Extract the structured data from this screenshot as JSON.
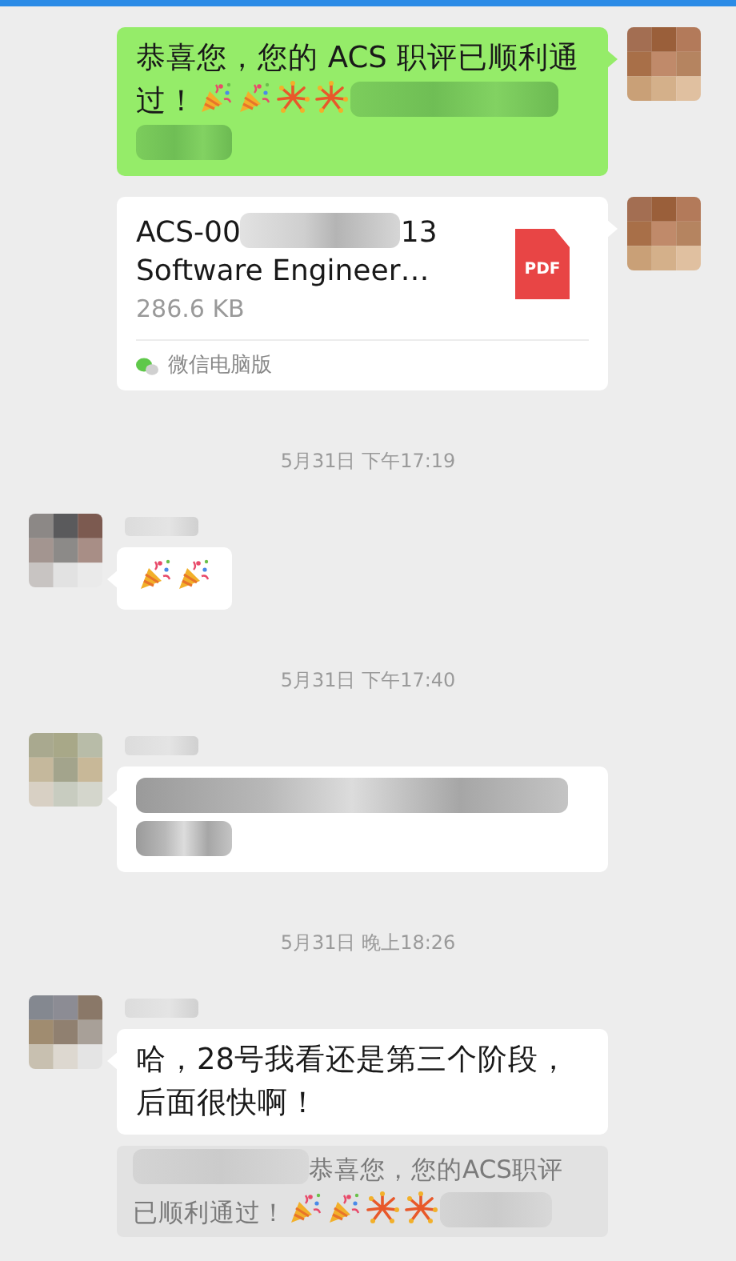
{
  "messages": [
    {
      "kind": "message",
      "outgoing": true,
      "segments": [
        {
          "kind": "text",
          "text": "恭喜您，您的 ACS 职评已顺利通"
        },
        {
          "kind": "text",
          "text": "过！"
        },
        {
          "kind": "popper"
        },
        {
          "kind": "popper"
        },
        {
          "kind": "fireworks"
        },
        {
          "kind": "fireworks"
        },
        {
          "kind": "redacted"
        },
        {
          "kind": "redacted"
        }
      ]
    },
    {
      "kind": "file",
      "outgoing": true,
      "title": [
        {
          "kind": "text",
          "text": "ACS-00"
        },
        {
          "kind": "redacted"
        },
        {
          "kind": "text",
          "text": "13"
        }
      ],
      "subtitle": "Software Engineer…",
      "size": "286.6 KB",
      "file_type": "PDF",
      "source": "微信电脑版"
    },
    {
      "kind": "time",
      "text": "5月31日 下午17:19"
    },
    {
      "kind": "message",
      "outgoing": false,
      "segments": [
        {
          "kind": "popper"
        },
        {
          "kind": "popper"
        }
      ]
    },
    {
      "kind": "time",
      "text": "5月31日 下午17:40"
    },
    {
      "kind": "message",
      "outgoing": false,
      "segments": [
        {
          "kind": "redacted"
        },
        {
          "kind": "redacted"
        }
      ]
    },
    {
      "kind": "time",
      "text": "5月31日 晚上18:26"
    },
    {
      "kind": "message",
      "outgoing": false,
      "segments": [
        {
          "kind": "text",
          "text": "哈，28号我看还是第三个阶段，后面很快啊！"
        }
      ],
      "quote": [
        {
          "kind": "redacted"
        },
        {
          "kind": "text",
          "text": "恭喜您，您的ACS职评"
        },
        {
          "kind": "text",
          "text": "已顺利通过！"
        },
        {
          "kind": "popper"
        },
        {
          "kind": "popper"
        },
        {
          "kind": "fireworks"
        },
        {
          "kind": "fireworks"
        },
        {
          "kind": "redacted"
        }
      ]
    }
  ]
}
